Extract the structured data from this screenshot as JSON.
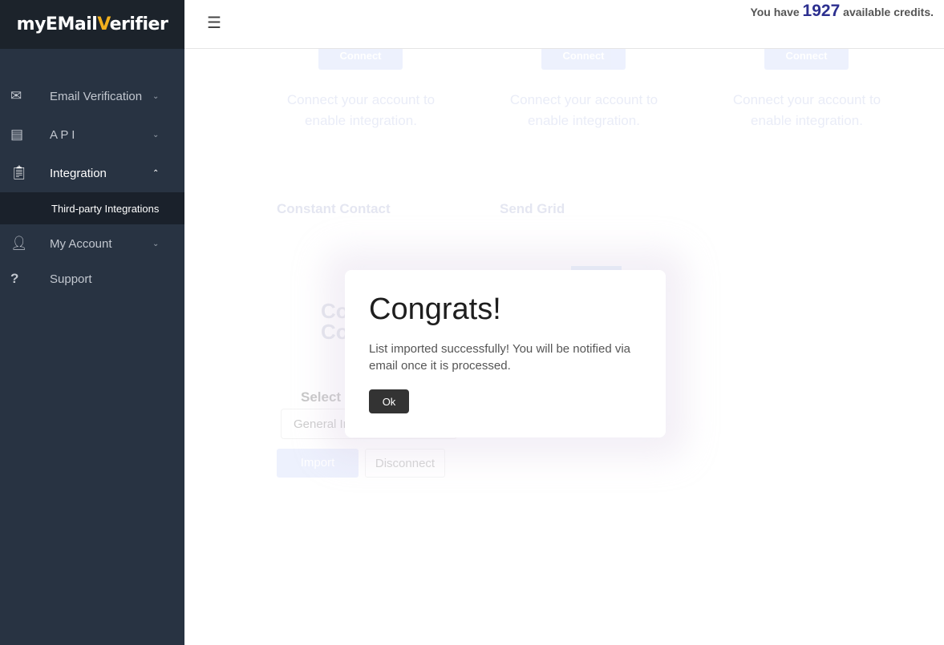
{
  "logo": {
    "pre": "myEMail",
    "v": "V",
    "post": "erifier"
  },
  "header": {
    "credits_prefix": "You have",
    "credits": "1927",
    "credits_suffix": "available credits."
  },
  "sidebar": {
    "items": [
      {
        "label": "Email Verification",
        "icon": "mail-icon"
      },
      {
        "label": "A P I",
        "icon": "document-icon"
      },
      {
        "label": "Integration",
        "icon": "clipboard-icon"
      },
      {
        "label": "My Account",
        "icon": "add-person-icon"
      },
      {
        "label": "Support",
        "icon": "question-icon"
      }
    ],
    "sub_item": "Third-party Integrations"
  },
  "background": {
    "connect": "Connect",
    "connect_text": "Connect your account to enable integration.",
    "cards": [
      "Constant Contact",
      "Send Grid"
    ],
    "select_label": "Select I",
    "select_value": "General In",
    "import": "Import",
    "disconnect": "Disconnect"
  },
  "modal": {
    "title": "Congrats!",
    "message": "List imported successfully! You will be notified via email once it is processed.",
    "ok": "Ok"
  }
}
